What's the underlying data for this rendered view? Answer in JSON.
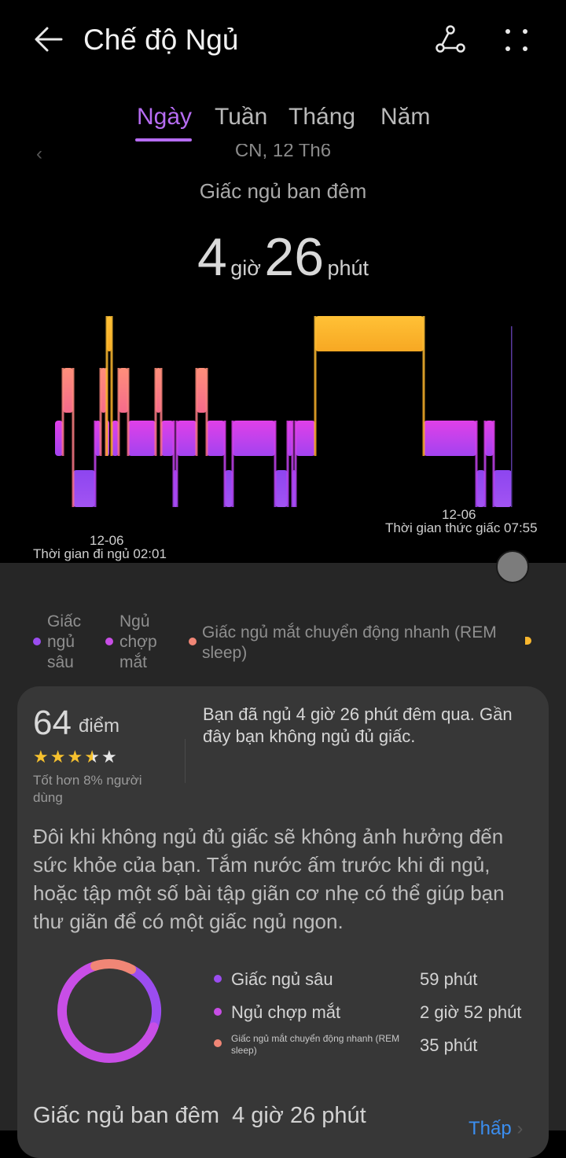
{
  "header": {
    "title": "Chế độ Ngủ",
    "back_icon": "arrow-left-icon",
    "share_icon": "share-icon",
    "more_icon": "more-dots-icon"
  },
  "tabs": [
    {
      "label": "Ngày",
      "active": true
    },
    {
      "label": "Tuần",
      "active": false
    },
    {
      "label": "Tháng",
      "active": false
    },
    {
      "label": "Năm",
      "active": false
    }
  ],
  "date_label": "CN, 12 Th6",
  "date_arrow": "‹",
  "subtitle": "Giấc ngủ ban đêm",
  "total": {
    "hours": "4",
    "hours_unit": "giờ",
    "minutes": "26",
    "minutes_unit": "phút"
  },
  "timeline": {
    "start_date": "12-06",
    "start_label": "Thời gian đi ngủ 02:01",
    "end_date": "12-06",
    "end_label": "Thời gian thức giấc 07:55"
  },
  "legend": [
    {
      "label": "Giấc\nngủ\nsâu",
      "color": "#9b4df0"
    },
    {
      "label": "Ngủ\nchợp\nmắt",
      "color": "#c84ee6"
    },
    {
      "label": "Giấc ngủ mắt chuyển động nhanh (REM\nsleep)",
      "color": "#f08676"
    }
  ],
  "colors": {
    "deep": "#9b4df0",
    "light": "#c84ee6",
    "rem": "#f08676",
    "awake": "#f9b72e",
    "accent": "#b66cf2",
    "link": "#3b8ef0"
  },
  "score": {
    "value": "64",
    "unit": "điểm",
    "stars": 3.5,
    "max_stars": 5,
    "better_than": "Tốt hơn 8% người dùng"
  },
  "summary": "Bạn đã ngủ 4 giờ 26 phút đêm qua. Gần đây bạn không ngủ đủ giấc.",
  "advice": "Đôi khi không ngủ đủ giấc sẽ không ảnh hưởng đến sức khỏe của bạn. Tắm nước ấm trước khi đi ngủ, hoặc tập một số bài tập giãn cơ nhẹ có thể giúp bạn thư giãn để có một giấc ngủ ngon.",
  "stats": [
    {
      "label": "Giấc ngủ sâu",
      "value": "59 phút",
      "minutes": 59,
      "color": "#9b4df0"
    },
    {
      "label": "Ngủ chợp mắt",
      "value": "2 giờ 52 phút",
      "minutes": 172,
      "color": "#c84ee6"
    },
    {
      "label": "Giấc ngủ mắt chuyển động nhanh (REM sleep)",
      "value": "35 phút",
      "minutes": 35,
      "color": "#f08676"
    }
  ],
  "bottom": {
    "title": "Giấc ngủ ban đêm",
    "value": "4 giờ 26 phút",
    "link": "Thấp"
  }
}
